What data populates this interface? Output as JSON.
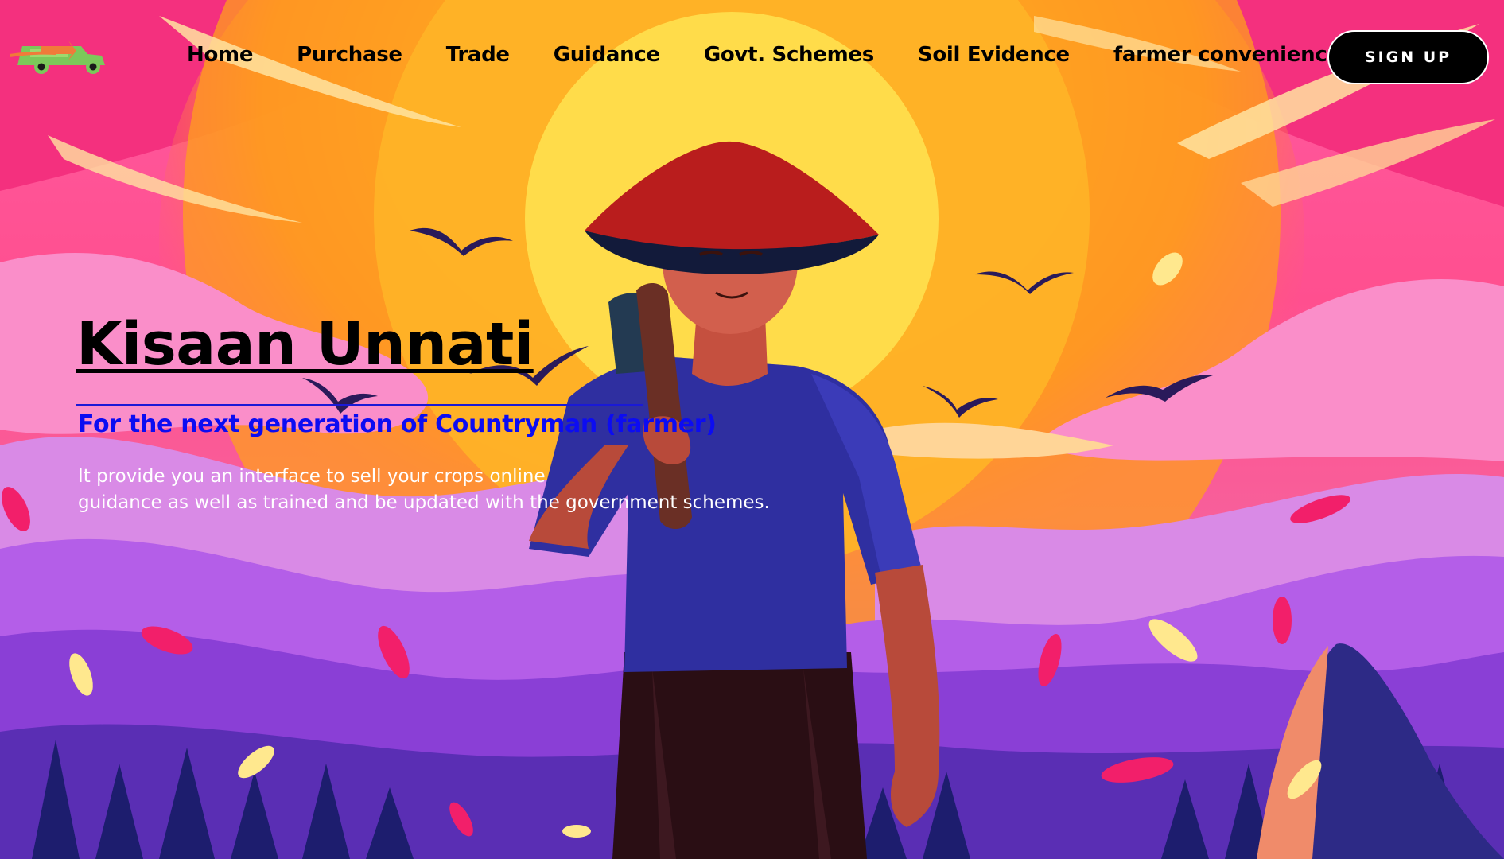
{
  "nav": {
    "items": [
      {
        "label": "Home"
      },
      {
        "label": "Purchase"
      },
      {
        "label": "Trade"
      },
      {
        "label": "Guidance"
      },
      {
        "label": "Govt. Schemes"
      },
      {
        "label": "Soil Evidence"
      },
      {
        "label": "farmer convenience"
      }
    ],
    "signup_label": "SIGN UP"
  },
  "hero": {
    "title": "Kisaan Unnati",
    "subtitle": "For the next generation of Countryman (farmer)",
    "description_line1": "It provide you an interface to sell your crops online",
    "description_line2": "guidance as well as trained and be updated with the government schemes."
  },
  "icons": {
    "logo": "truck-logo-icon",
    "hero_image": "farmer-sunset-illustration"
  },
  "colors": {
    "subtitle": "#0c0cf2",
    "signup_bg": "#000000",
    "sun": "#ffd84a",
    "sky_pink": "#f0388a",
    "sky_orange": "#ffa51e",
    "purple": "#9a3fe0",
    "shirt": "#2f2fa0"
  }
}
